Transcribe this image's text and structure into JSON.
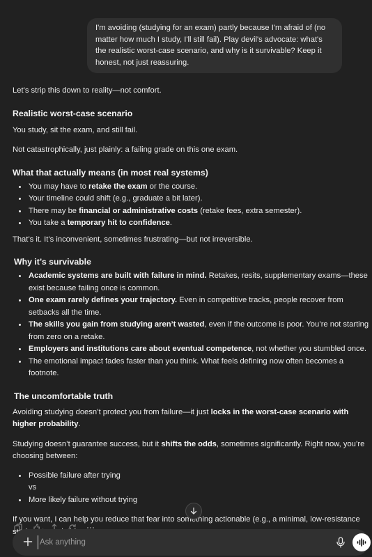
{
  "user_message": "I'm avoiding (studying for an exam) partly because I'm afraid of (no matter how much I study, I'll still fail). Play devil's advocate: what's the realistic worst-case scenario, and why is it survivable? Keep it honest, not just reassuring.",
  "response": {
    "intro": "Let’s strip this down to reality—not comfort.",
    "worst_case": {
      "heading": "Realistic worst-case scenario",
      "p1": "You study, sit the exam, and still fail.",
      "p2": "Not catastrophically, just plainly: a failing grade on this one exam."
    },
    "means": {
      "heading": "What that actually means (in most real systems)",
      "items": [
        {
          "pre": "You may have to ",
          "bold": "retake the exam",
          "post": " or the course."
        },
        {
          "pre": "Your timeline could shift (e.g., graduate a bit later).",
          "bold": "",
          "post": ""
        },
        {
          "pre": "There may be ",
          "bold": "financial or administrative costs",
          "post": " (retake fees, extra semester)."
        },
        {
          "pre": "You take a ",
          "bold": "temporary hit to confidence",
          "post": "."
        }
      ],
      "closing": "That’s it. It’s inconvenient, sometimes frustrating—but not irreversible."
    },
    "survivable": {
      "heading": "Why it’s survivable",
      "items": [
        {
          "bold": "Academic systems are built with failure in mind.",
          "post": " Retakes, resits, supplementary exams—these exist because failing once is common."
        },
        {
          "bold": "One exam rarely defines your trajectory.",
          "post": " Even in competitive tracks, people recover from setbacks all the time."
        },
        {
          "bold": "The skills you gain from studying aren’t wasted",
          "post": ", even if the outcome is poor. You’re not starting from zero on a retake."
        },
        {
          "bold": "Employers and institutions care about eventual competence",
          "post": ", not whether you stumbled once."
        },
        {
          "bold": "",
          "post": "The emotional impact fades faster than you think. What feels defining now often becomes a footnote."
        }
      ]
    },
    "truth": {
      "heading": "The uncomfortable truth",
      "p1_pre": "Avoiding studying doesn’t protect you from failure—it just ",
      "p1_bold": "locks in the worst-case scenario with higher probability",
      "p1_post": ".",
      "p2_pre": "Studying doesn’t guarantee success, but it ",
      "p2_bold": "shifts the odds",
      "p2_post": ", sometimes significantly. Right now, you’re choosing between:",
      "option1": "Possible failure after trying",
      "vs": "vs",
      "option2": "More likely failure without trying",
      "offer": "If you want, I can help you reduce that fear into something actionable (e.g., a minimal, low-resistance study entry point)."
    }
  },
  "composer": {
    "placeholder": "Ask anything"
  },
  "icons": {
    "add": "plus-icon",
    "mic": "microphone-icon",
    "voice": "voice-mode-icon",
    "scroll": "arrow-down-icon",
    "copy": "copy-icon",
    "like": "thumbs-up-icon",
    "dislike": "thumbs-down-icon",
    "share": "share-icon",
    "regenerate": "regenerate-icon",
    "more": "more-icon"
  }
}
